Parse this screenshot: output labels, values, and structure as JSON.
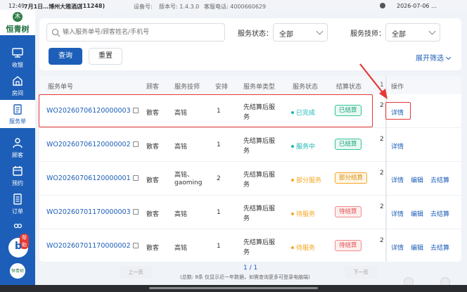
{
  "statusbar": {
    "time": "12:49",
    "shop": "7月1日…博州大雅酒店",
    "code": "(11248)",
    "device": "设备号:",
    "version": "版本号: 1.4.3.0",
    "tel": "客服电话: 4000660629",
    "right": "2026-07-06 …"
  },
  "sidebar": {
    "brand": "恒青树",
    "items": [
      {
        "label": "收银",
        "icon": "monitor-icon"
      },
      {
        "label": "房间",
        "icon": "home-icon"
      },
      {
        "label": "服务单",
        "icon": "clipboard-icon"
      },
      {
        "label": "顾客",
        "icon": "user-icon"
      },
      {
        "label": "预约",
        "icon": "calendar-icon"
      },
      {
        "label": "订单",
        "icon": "document-icon"
      },
      {
        "label": "",
        "icon": "users-icon"
      }
    ],
    "help_tag": "帮助",
    "help_letter": "b",
    "bottom_logo": "恒青树"
  },
  "filters": {
    "search_placeholder": "输入服务单号/顾客姓名/手机号",
    "status_label": "服务状态：",
    "status_value": "全部",
    "tech_label": "服务技师：",
    "tech_value": "全部",
    "query_button": "查询",
    "reset_button": "重置",
    "expand_label": "展开筛选"
  },
  "table": {
    "headers": [
      "服务单号",
      "顾客",
      "服务技师",
      "安排",
      "服务单类型",
      "服务状态",
      "结算状态",
      "1",
      "操作"
    ],
    "rows": [
      {
        "order": "WO20260706120000003",
        "customer": "散客",
        "tech": "高铭",
        "tech2": "",
        "arrange": "1",
        "type1": "先结算后服",
        "type2": "务",
        "status": "已完成",
        "status_color": "#1fb6b6",
        "settle": "已结算",
        "settle_style": "green",
        "frag": "2",
        "ops": [
          "详情"
        ]
      },
      {
        "order": "WO20260706120000002",
        "customer": "散客",
        "tech": "高铭",
        "tech2": "",
        "arrange": "1",
        "type1": "先结算后服",
        "type2": "务",
        "status": "服务中",
        "status_color": "#1fb6b6",
        "settle": "已结算",
        "settle_style": "green",
        "frag": "2",
        "ops": [
          "详情"
        ]
      },
      {
        "order": "WO20260706120000001",
        "customer": "散客",
        "tech": "高铭、",
        "tech2": "gaoming",
        "arrange": "2",
        "type1": "先结算后服",
        "type2": "务",
        "status": "部分服务",
        "status_color": "#f5a623",
        "settle": "部分结算",
        "settle_style": "orange",
        "frag": "2",
        "ops": [
          "详情",
          "编辑",
          "去结算"
        ]
      },
      {
        "order": "WO20260701170000003",
        "customer": "散客",
        "tech": "高铭",
        "tech2": "",
        "arrange": "1",
        "type1": "先结算后服",
        "type2": "务",
        "status": "待服务",
        "status_color": "#f5a623",
        "settle": "待结算",
        "settle_style": "red",
        "frag": "2",
        "ops": [
          "详情",
          "编辑",
          "去结算"
        ]
      },
      {
        "order": "WO20260701170000002",
        "customer": "散客",
        "tech": "高铭",
        "tech2": "",
        "arrange": "1",
        "type1": "先结算后服",
        "type2": "务",
        "status": "待服务",
        "status_color": "#f5a623",
        "settle": "待结算",
        "settle_style": "red",
        "frag": "2",
        "ops": [
          "详情",
          "编辑",
          "去结算"
        ]
      }
    ]
  },
  "pager": {
    "prev": "上一页",
    "next": "下一页",
    "page": "1 / 1",
    "note": "(总数: 8条 仅显示近一年数据，如需查询更多可登录电脑端)"
  },
  "colors": {
    "brand_blue": "#1d5fb8",
    "highlight_red": "#e53935"
  }
}
